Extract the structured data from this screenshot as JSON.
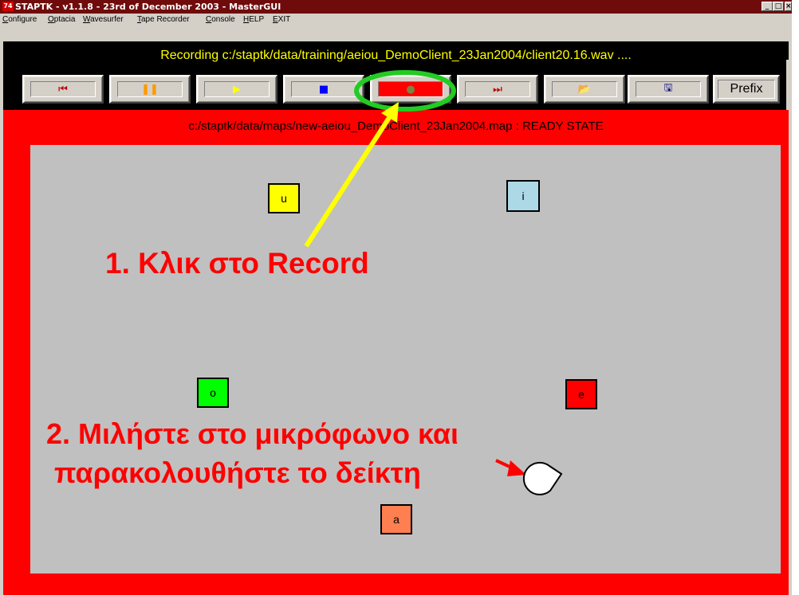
{
  "window": {
    "icon_text": "74",
    "title": "STAPTK - v1.1.8 - 23rd of December 2003 - MasterGUI",
    "controls": {
      "minimize": "_",
      "maximize": "□",
      "close": "×"
    }
  },
  "menu": [
    "Configure",
    "Optacia",
    "Wavesurfer",
    "Tape Recorder",
    "Console",
    "HELP",
    "EXIT"
  ],
  "status_text": "Recording c:/staptk/data/training/aeiou_DemoClient_23Jan2004/client20.16.wav ....",
  "toolbar": {
    "buttons": [
      {
        "name": "rewind-to-start",
        "icon": "skip-back-icon",
        "glyph": "⏮",
        "color": "#c00000"
      },
      {
        "name": "pause",
        "icon": "pause-icon",
        "glyph": "❚❚",
        "color": "#ff9900"
      },
      {
        "name": "play",
        "icon": "play-icon",
        "glyph": "▶",
        "color": "#ffff00"
      },
      {
        "name": "stop",
        "icon": "stop-icon",
        "glyph": "■",
        "color": "#0000ff"
      },
      {
        "name": "record",
        "icon": "record-icon",
        "glyph": "●",
        "color": "#808040"
      },
      {
        "name": "skip-to-end",
        "icon": "skip-forward-icon",
        "glyph": "⏭",
        "color": "#c00000"
      },
      {
        "name": "open",
        "icon": "open-folder-icon",
        "glyph": "📂",
        "color": "#806000"
      },
      {
        "name": "save",
        "icon": "save-disk-icon",
        "glyph": "🖫",
        "color": "#000080"
      }
    ],
    "prefix_label": "Prefix"
  },
  "map_status": "c:/staptk/data/maps/new-aeiou_DemoClient_23Jan2004.map : READY STATE",
  "vowels": [
    {
      "label": "u",
      "color": "#ffff00"
    },
    {
      "label": "i",
      "color": "#add8e6"
    },
    {
      "label": "o",
      "color": "#00ff00"
    },
    {
      "label": "e",
      "color": "#ff0000"
    },
    {
      "label": "a",
      "color": "#ff7f50"
    }
  ],
  "annotations": {
    "step1": "1. Κλικ στο Record",
    "step2_line1": "2. Μιλήστε στο μικρόφωνο και",
    "step2_line2": "παρακολουθήστε το δείκτη"
  },
  "colors": {
    "frame": "#ff0000",
    "canvas": "#c0c0c0",
    "status_text": "#ffff00",
    "highlight_ellipse": "#22cc22",
    "arrow": "#ffff00",
    "annotation": "#ff0000"
  }
}
